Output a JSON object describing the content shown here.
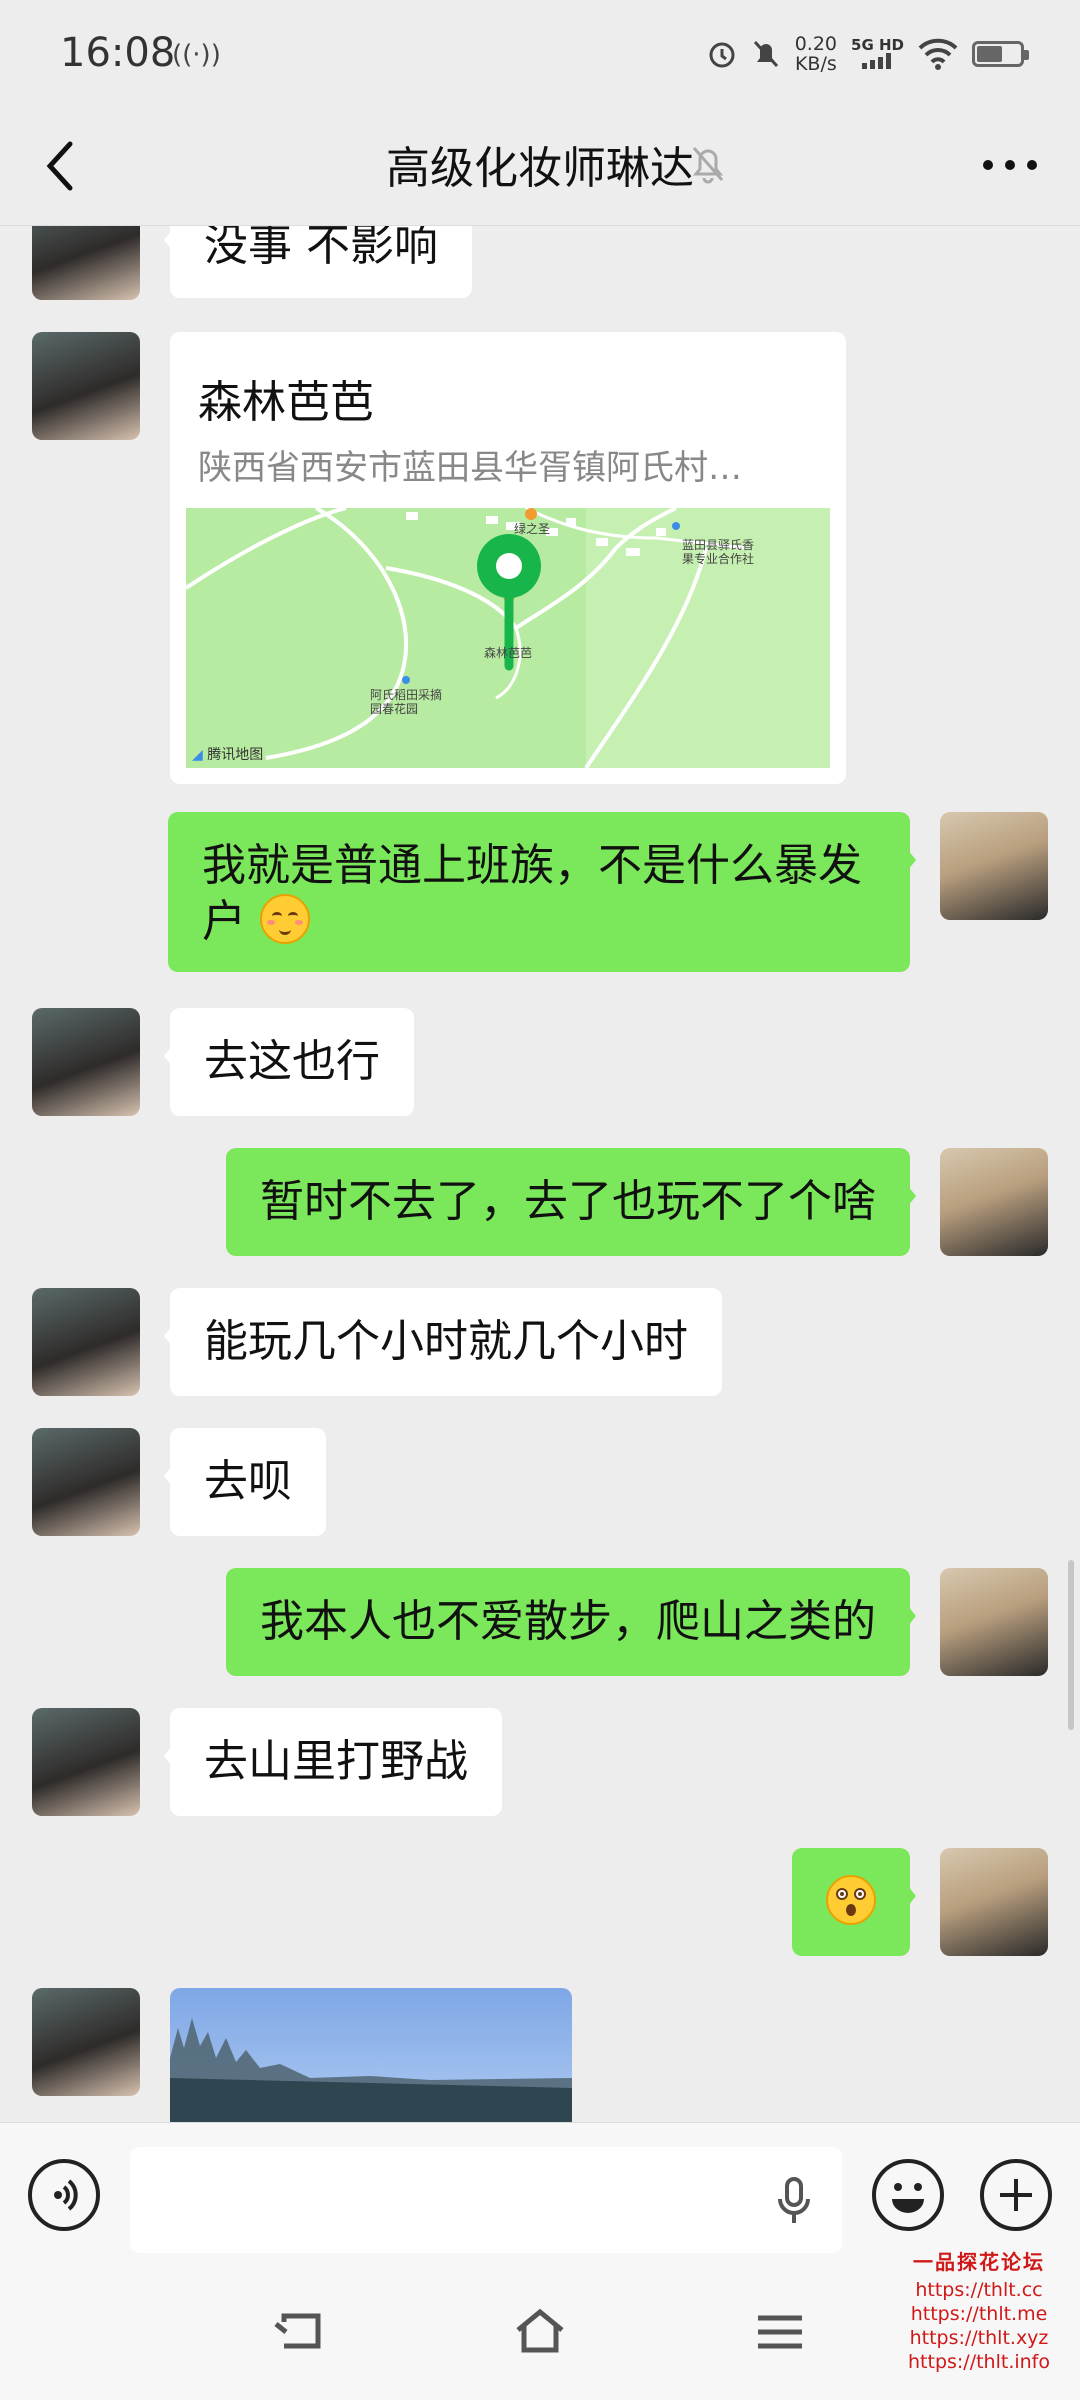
{
  "status_bar": {
    "time": "16:08",
    "speed_value": "0.20",
    "speed_unit": "KB/s",
    "network": "5G HD",
    "battery_level": 0.55
  },
  "header": {
    "title": "高级化妆师琳达"
  },
  "messages": [
    {
      "side": "in",
      "type": "text",
      "text": "没事 不影响"
    },
    {
      "side": "in",
      "type": "location",
      "name": "森林芭芭",
      "address": "陕西省西安市蓝田县华胥镇阿氏村…",
      "map_labels": [
        "绿之圣",
        "蓝田县驿氏香果专业合作社",
        "森林芭芭",
        "阿氏稻田采摘园春花园"
      ],
      "map_provider": "腾讯地图"
    },
    {
      "side": "out",
      "type": "text",
      "text": "我就是普通上班族，不是什么暴发户"
    },
    {
      "side": "in",
      "type": "text",
      "text": "去这也行"
    },
    {
      "side": "out",
      "type": "text",
      "text": "暂时不去了，去了也玩不了个啥"
    },
    {
      "side": "in",
      "type": "text",
      "text": "能玩几个小时就几个小时"
    },
    {
      "side": "in",
      "type": "text",
      "text": "去呗"
    },
    {
      "side": "out",
      "type": "text",
      "text": "我本人也不爱散步，爬山之类的"
    },
    {
      "side": "in",
      "type": "text",
      "text": "去山里打野战"
    },
    {
      "side": "out",
      "type": "emoji",
      "icon": "surprised-emoji"
    },
    {
      "side": "in",
      "type": "image"
    }
  ],
  "watermark": {
    "title": "一品探花论坛",
    "links": [
      "https://thlt.cc",
      "https://thlt.me",
      "https://thlt.xyz",
      "https://thlt.info"
    ]
  },
  "colors": {
    "background": "#ededed",
    "outgoing_bubble": "#7ae85a",
    "incoming_bubble": "#ffffff",
    "map_pin": "#18b54a",
    "watermark": "#d01818"
  }
}
